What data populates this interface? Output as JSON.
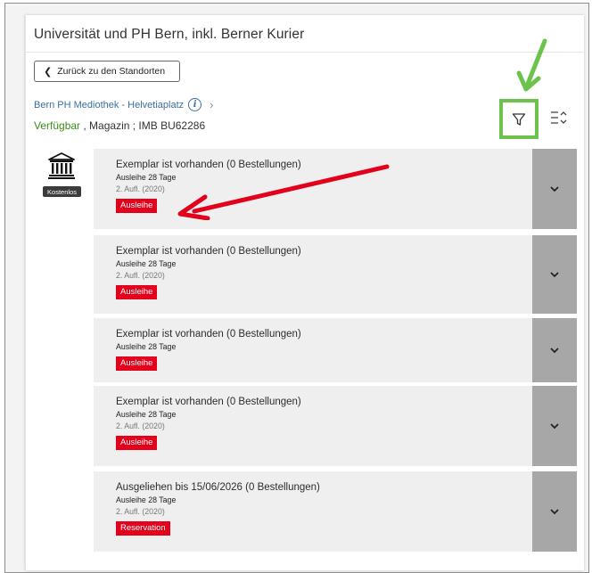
{
  "institution": {
    "title": "Universität und PH Bern, inkl. Berner Kurier"
  },
  "back_button": {
    "label": "Zurück zu den Standorten"
  },
  "location": {
    "name": "Bern PH Mediothek - Helvetiaplatz",
    "availability": "Verfügbar",
    "details": " , Magazin ; IMB BU62286"
  },
  "badge": {
    "label": "Kostenlos"
  },
  "items": [
    {
      "title": "Exemplar ist vorhanden (0 Bestellungen)",
      "loan": "Ausleihe 28 Tage",
      "edition": "2. Aufl. (2020)",
      "action": "Ausleihe"
    },
    {
      "title": "Exemplar ist vorhanden (0 Bestellungen)",
      "loan": "Ausleihe 28 Tage",
      "edition": "2. Aufl. (2020)",
      "action": "Ausleihe"
    },
    {
      "title": "Exemplar ist vorhanden (0 Bestellungen)",
      "loan": "Ausleihe 28 Tage",
      "edition": "",
      "action": "Ausleihe"
    },
    {
      "title": "Exemplar ist vorhanden (0 Bestellungen)",
      "loan": "Ausleihe 28 Tage",
      "edition": "2. Aufl. (2020)",
      "action": "Ausleihe"
    },
    {
      "title": "Ausgeliehen bis 15/06/2026 (0 Bestellungen)",
      "loan": "Ausleihe 28 Tage",
      "edition": "2. Aufl. (2020)",
      "action": "Reservation"
    }
  ],
  "icons": {
    "back": "chevron-left-icon",
    "info": "info-icon",
    "location_next": "chevron-right-icon",
    "filter": "filter-icon",
    "sort": "sort-icon",
    "library": "library-building-icon",
    "expand": "chevron-down-icon"
  },
  "colors": {
    "available": "#3b8d1b",
    "action_tag": "#e2001a",
    "link": "#3a6fa0",
    "highlight_box": "#6cc24a",
    "annotation_arrow": "#e2001a"
  }
}
